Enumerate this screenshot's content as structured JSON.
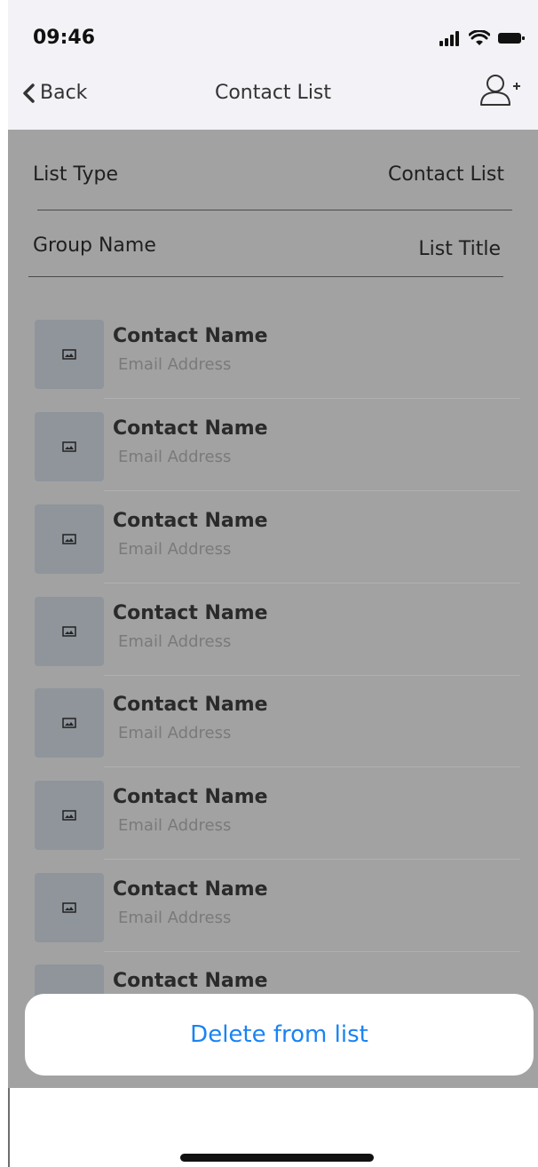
{
  "status": {
    "time": "09:46"
  },
  "nav": {
    "back_label": "Back",
    "title": "Contact List"
  },
  "form": {
    "list_type_label": "List Type",
    "list_type_value": "Contact List",
    "group_name_label": "Group Name",
    "group_name_value": "List Title"
  },
  "contacts": [
    {
      "name": "Contact Name",
      "email": "Email Address"
    },
    {
      "name": "Contact Name",
      "email": "Email Address"
    },
    {
      "name": "Contact Name",
      "email": "Email Address"
    },
    {
      "name": "Contact Name",
      "email": "Email Address"
    },
    {
      "name": "Contact Name",
      "email": "Email Address"
    },
    {
      "name": "Contact Name",
      "email": "Email Address"
    },
    {
      "name": "Contact Name",
      "email": "Email Address"
    },
    {
      "name": "Contact Name",
      "email": ""
    }
  ],
  "action_sheet": {
    "delete_label": "Delete from list"
  },
  "colors": {
    "accent": "#1a83f2",
    "overlay": "#a2a2a2",
    "nav_bg": "#f3f3f7"
  }
}
